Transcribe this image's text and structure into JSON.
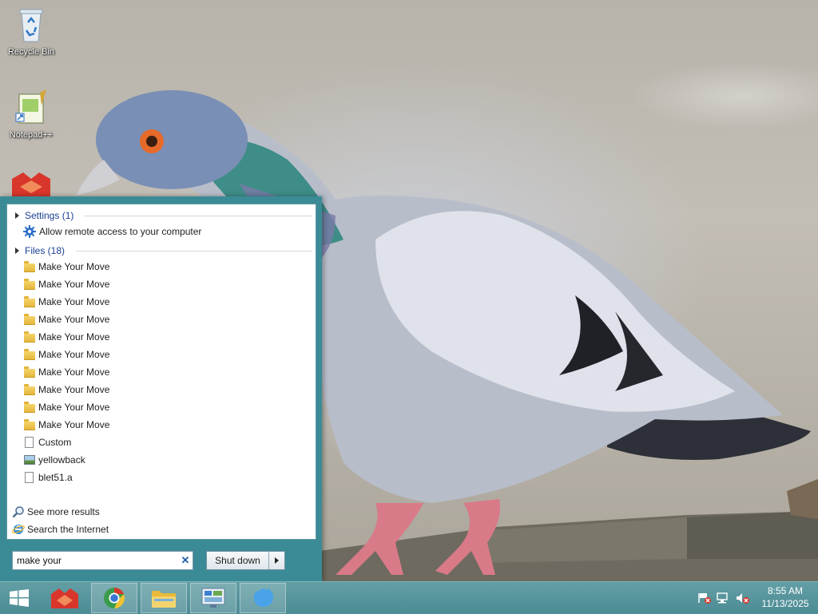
{
  "desktop": {
    "icons": [
      {
        "label": "Recycle Bin"
      },
      {
        "label": "Notepad++"
      }
    ]
  },
  "start_menu": {
    "groups": {
      "settings": {
        "label": "Settings (1)",
        "items": [
          {
            "label": "Allow remote access to your computer",
            "icon": "gear-icon"
          }
        ]
      },
      "files": {
        "label": "Files (18)",
        "items": [
          {
            "label": "Make Your Move",
            "icon": "folder-icon"
          },
          {
            "label": "Make Your Move",
            "icon": "folder-icon"
          },
          {
            "label": "Make Your Move",
            "icon": "folder-icon"
          },
          {
            "label": "Make Your Move",
            "icon": "folder-icon"
          },
          {
            "label": "Make Your Move",
            "icon": "folder-icon"
          },
          {
            "label": "Make Your Move",
            "icon": "folder-icon"
          },
          {
            "label": "Make Your Move",
            "icon": "folder-icon"
          },
          {
            "label": "Make Your Move",
            "icon": "folder-icon"
          },
          {
            "label": "Make Your Move",
            "icon": "folder-icon"
          },
          {
            "label": "Make Your Move",
            "icon": "folder-icon"
          },
          {
            "label": "Custom",
            "icon": "document-icon"
          },
          {
            "label": "yellowback",
            "icon": "image-icon"
          },
          {
            "label": "blet51.a",
            "icon": "document-icon"
          }
        ]
      }
    },
    "see_more": "See more results",
    "search_internet": "Search the Internet",
    "search_value": "make your",
    "shutdown_label": "Shut down"
  },
  "taskbar": {
    "apps": [
      "start-icon",
      "app-icon",
      "chrome-icon",
      "file-explorer-icon",
      "control-panel-icon",
      "bird-app-icon"
    ],
    "tray_icons": [
      "action-center-flag-icon",
      "network-icon",
      "volume-muted-icon"
    ],
    "time": "8:55 AM",
    "date": "11/13/2025"
  },
  "colors": {
    "start_menu_frame": "#3a8b96",
    "taskbar": "#5e9ea6",
    "group_header": "#1a3f92"
  }
}
